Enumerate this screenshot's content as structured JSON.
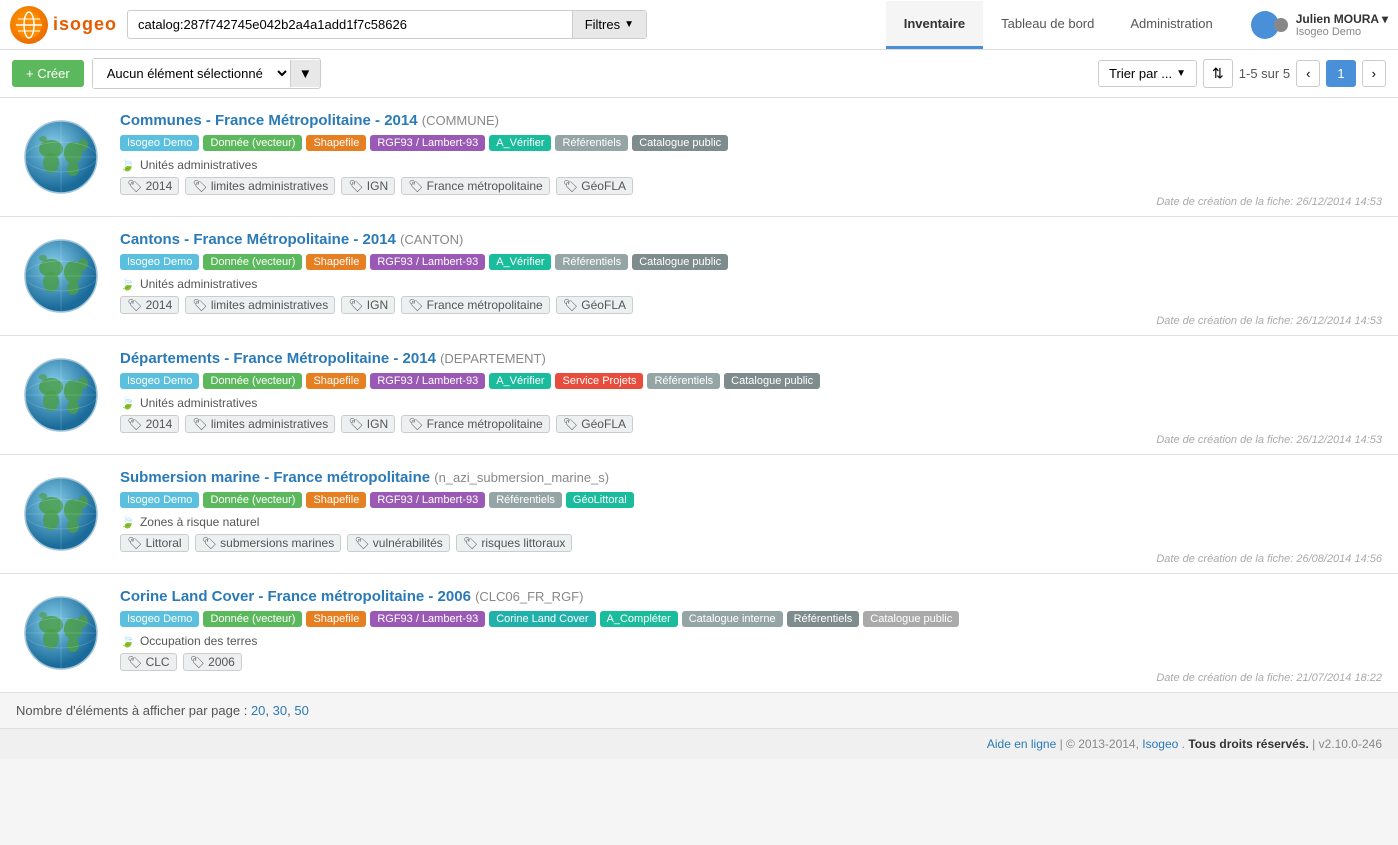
{
  "header": {
    "logo_text": "isogeo",
    "search_value": "catalog:287f742745e042b2a4a1add1f7c58626",
    "filter_label": "Filtres",
    "nav": [
      {
        "id": "inventaire",
        "label": "Inventaire",
        "active": true
      },
      {
        "id": "tableau",
        "label": "Tableau de bord",
        "active": false
      },
      {
        "id": "admin",
        "label": "Administration",
        "active": false
      }
    ],
    "user_name": "Julien MOURA ▾",
    "user_org": "Isogeo Demo"
  },
  "toolbar": {
    "create_label": "+ Créer",
    "select_placeholder": "Aucun élément sélectionné",
    "sort_label": "Trier par ...",
    "page_info": "1-5 sur 5",
    "page_current": "1"
  },
  "results": [
    {
      "id": "result-1",
      "title": "Communes - France Métropolitaine - 2014",
      "type_code": "(COMMUNE)",
      "tags": [
        {
          "label": "Isogeo Demo",
          "color": "blue"
        },
        {
          "label": "Donnée (vecteur)",
          "color": "green"
        },
        {
          "label": "Shapefile",
          "color": "orange"
        },
        {
          "label": "RGF93 / Lambert-93",
          "color": "purple"
        },
        {
          "label": "A_Vérifier",
          "color": "teal"
        },
        {
          "label": "Référentiels",
          "color": "gray"
        },
        {
          "label": "Catalogue public",
          "color": "dark"
        }
      ],
      "theme": "Unités administratives",
      "keywords": [
        "2014",
        "limites administratives",
        "IGN",
        "France métropolitaine",
        "GéoFLA"
      ],
      "date": "Date de création de la fiche: 26/12/2014 14:53"
    },
    {
      "id": "result-2",
      "title": "Cantons - France Métropolitaine - 2014",
      "type_code": "(CANTON)",
      "tags": [
        {
          "label": "Isogeo Demo",
          "color": "blue"
        },
        {
          "label": "Donnée (vecteur)",
          "color": "green"
        },
        {
          "label": "Shapefile",
          "color": "orange"
        },
        {
          "label": "RGF93 / Lambert-93",
          "color": "purple"
        },
        {
          "label": "A_Vérifier",
          "color": "teal"
        },
        {
          "label": "Référentiels",
          "color": "gray"
        },
        {
          "label": "Catalogue public",
          "color": "dark"
        }
      ],
      "theme": "Unités administratives",
      "keywords": [
        "2014",
        "limites administratives",
        "IGN",
        "France métropolitaine",
        "GéoFLA"
      ],
      "date": "Date de création de la fiche: 26/12/2014 14:53"
    },
    {
      "id": "result-3",
      "title": "Départements - France Métropolitaine - 2014",
      "type_code": "(DEPARTEMENT)",
      "tags": [
        {
          "label": "Isogeo Demo",
          "color": "blue"
        },
        {
          "label": "Donnée (vecteur)",
          "color": "green"
        },
        {
          "label": "Shapefile",
          "color": "orange"
        },
        {
          "label": "RGF93 / Lambert-93",
          "color": "purple"
        },
        {
          "label": "A_Vérifier",
          "color": "teal"
        },
        {
          "label": "Service Projets",
          "color": "red"
        },
        {
          "label": "Référentiels",
          "color": "gray"
        },
        {
          "label": "Catalogue public",
          "color": "dark"
        }
      ],
      "theme": "Unités administratives",
      "keywords": [
        "2014",
        "limites administratives",
        "IGN",
        "France métropolitaine",
        "GéoFLA"
      ],
      "date": "Date de création de la fiche: 26/12/2014 14:53"
    },
    {
      "id": "result-4",
      "title": "Submersion marine - France métropolitaine",
      "type_code": "(n_azi_submersion_marine_s)",
      "tags": [
        {
          "label": "Isogeo Demo",
          "color": "blue"
        },
        {
          "label": "Donnée (vecteur)",
          "color": "green"
        },
        {
          "label": "Shapefile",
          "color": "orange"
        },
        {
          "label": "RGF93 / Lambert-93",
          "color": "purple"
        },
        {
          "label": "Référentiels",
          "color": "gray"
        },
        {
          "label": "GéoLittoral",
          "color": "teal"
        }
      ],
      "theme": "Zones à risque naturel",
      "keywords": [
        "Littoral",
        "submersions marines",
        "vulnérabilités",
        "risques littoraux"
      ],
      "date": "Date de création de la fiche: 26/08/2014 14:56"
    },
    {
      "id": "result-5",
      "title": "Corine Land Cover - France métropolitaine - 2006",
      "type_code": "(CLC06_FR_RGF)",
      "tags": [
        {
          "label": "Isogeo Demo",
          "color": "blue"
        },
        {
          "label": "Donnée (vecteur)",
          "color": "green"
        },
        {
          "label": "Shapefile",
          "color": "orange"
        },
        {
          "label": "RGF93 / Lambert-93",
          "color": "purple"
        },
        {
          "label": "Corine Land Cover",
          "color": "corine"
        },
        {
          "label": "A_Compléter",
          "color": "teal"
        },
        {
          "label": "Catalogue interne",
          "color": "gray"
        },
        {
          "label": "Référentiels",
          "color": "dark"
        },
        {
          "label": "Catalogue public",
          "color": "lightgray"
        }
      ],
      "theme": "Occupation des terres",
      "keywords": [
        "CLC",
        "2006"
      ],
      "date": "Date de création de la fiche: 21/07/2014 18:22"
    }
  ],
  "footer": {
    "items_per_page_label": "Nombre d'éléments à afficher par page :",
    "items_20": "20",
    "items_30": "30",
    "items_50": "50",
    "bottom_text": "Aide en ligne | © 2013-2014, Isogeo.",
    "rights_text": "Tous droits réservés.",
    "version": "| v2.10.0-246"
  }
}
